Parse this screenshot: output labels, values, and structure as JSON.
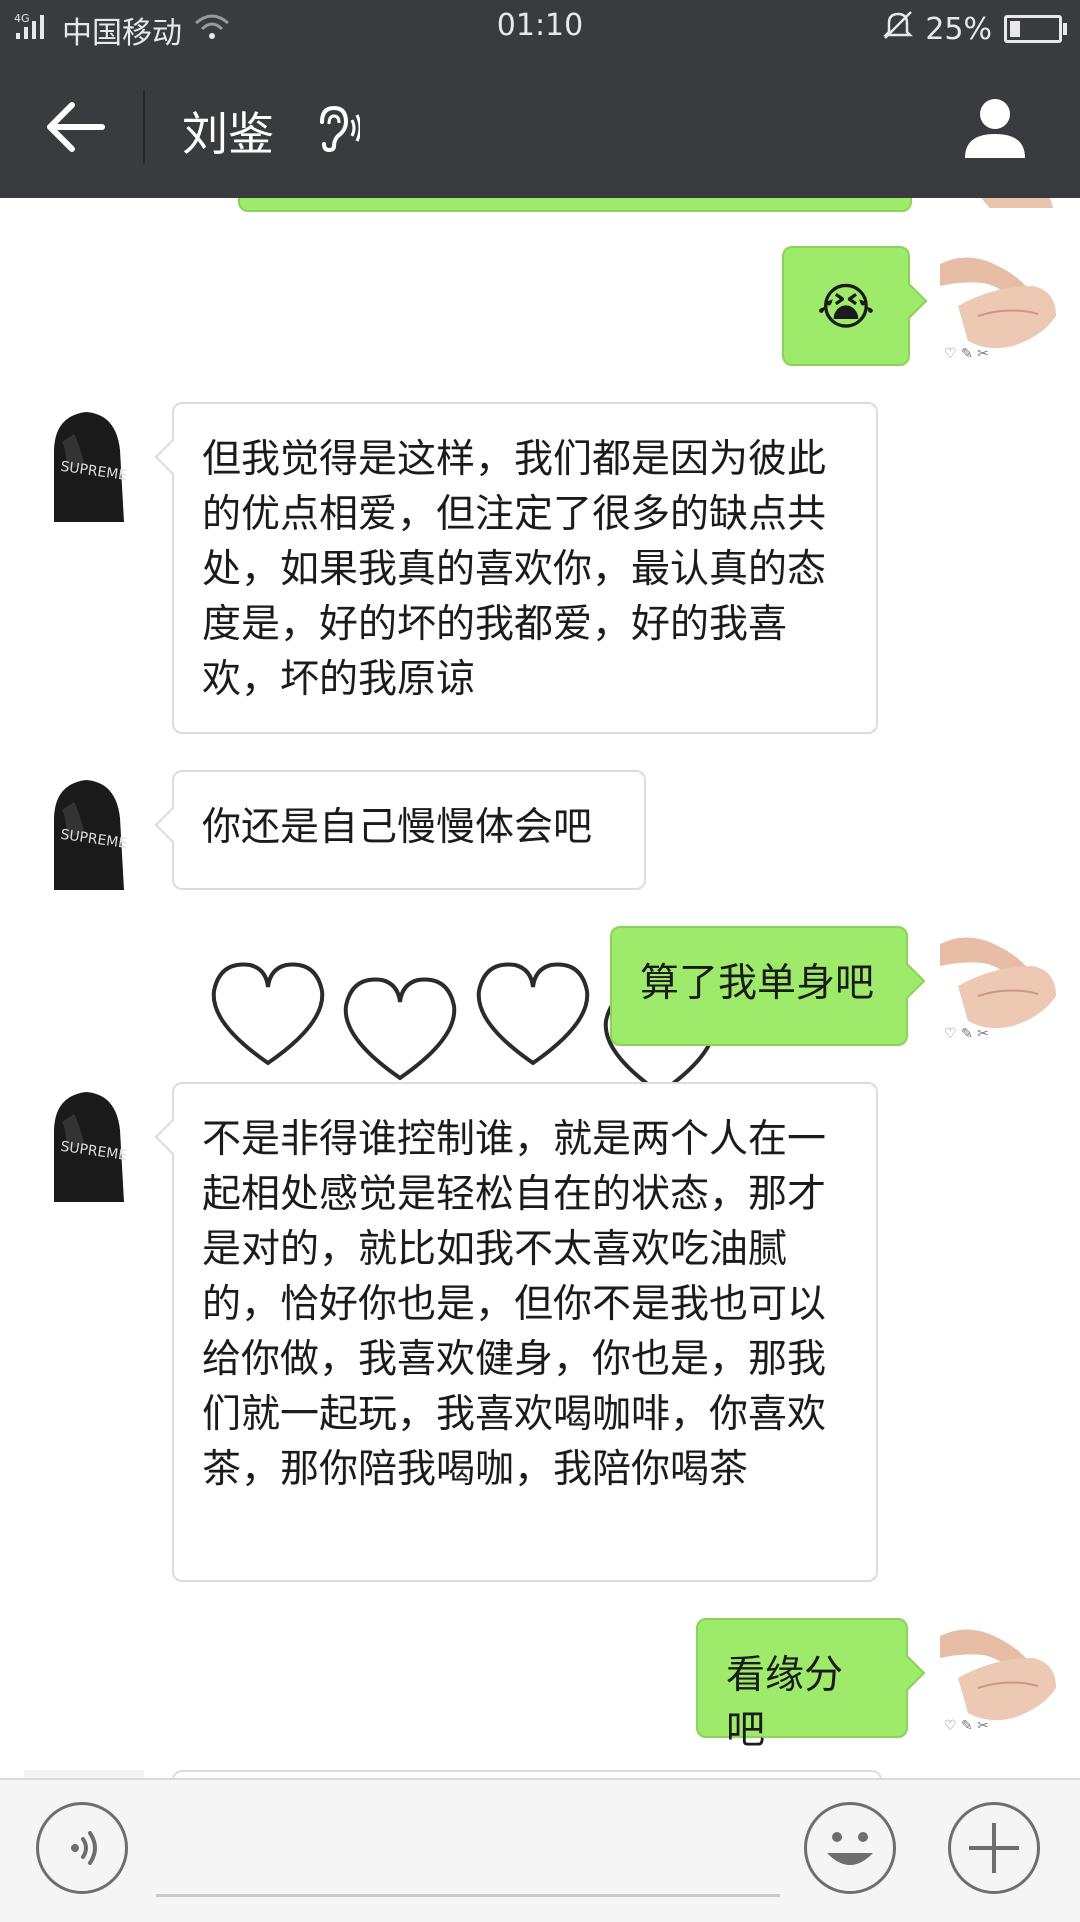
{
  "status_bar": {
    "network": "4G",
    "carrier": "中国移动",
    "time": "01:10",
    "battery": "25%"
  },
  "header": {
    "title": "刘鉴",
    "icons": [
      "back-arrow-icon",
      "ear-icon",
      "profile-icon"
    ]
  },
  "messages": [
    {
      "side": "right",
      "type": "emoji",
      "content": "😭"
    },
    {
      "side": "left",
      "text": "但我觉得是这样，我们都是因为彼此的优点相爱，但注定了很多的缺点共处，如果我真的喜欢你，最认真的态度是，好的坏的我都爱，好的我喜欢，坏的我原谅"
    },
    {
      "side": "left",
      "text": "你还是自己慢慢体会吧"
    },
    {
      "side": "right",
      "text": "算了我单身吧"
    },
    {
      "side": "left",
      "text": "不是非得谁控制谁，就是两个人在一起相处感觉是轻松自在的状态，那才是对的，就比如我不太喜欢吃油腻的，恰好你也是，但你不是我也可以给你做，我喜欢健身，你也是，那我们就一起玩，我喜欢喝咖啡，你喜欢茶，那你陪我喝咖，我陪你喝茶"
    },
    {
      "side": "right",
      "text": "看缘分吧"
    }
  ],
  "colors": {
    "header_bg": "#3a3b3e",
    "bubble_right": "#9eea6a",
    "bubble_left": "#ffffff"
  }
}
